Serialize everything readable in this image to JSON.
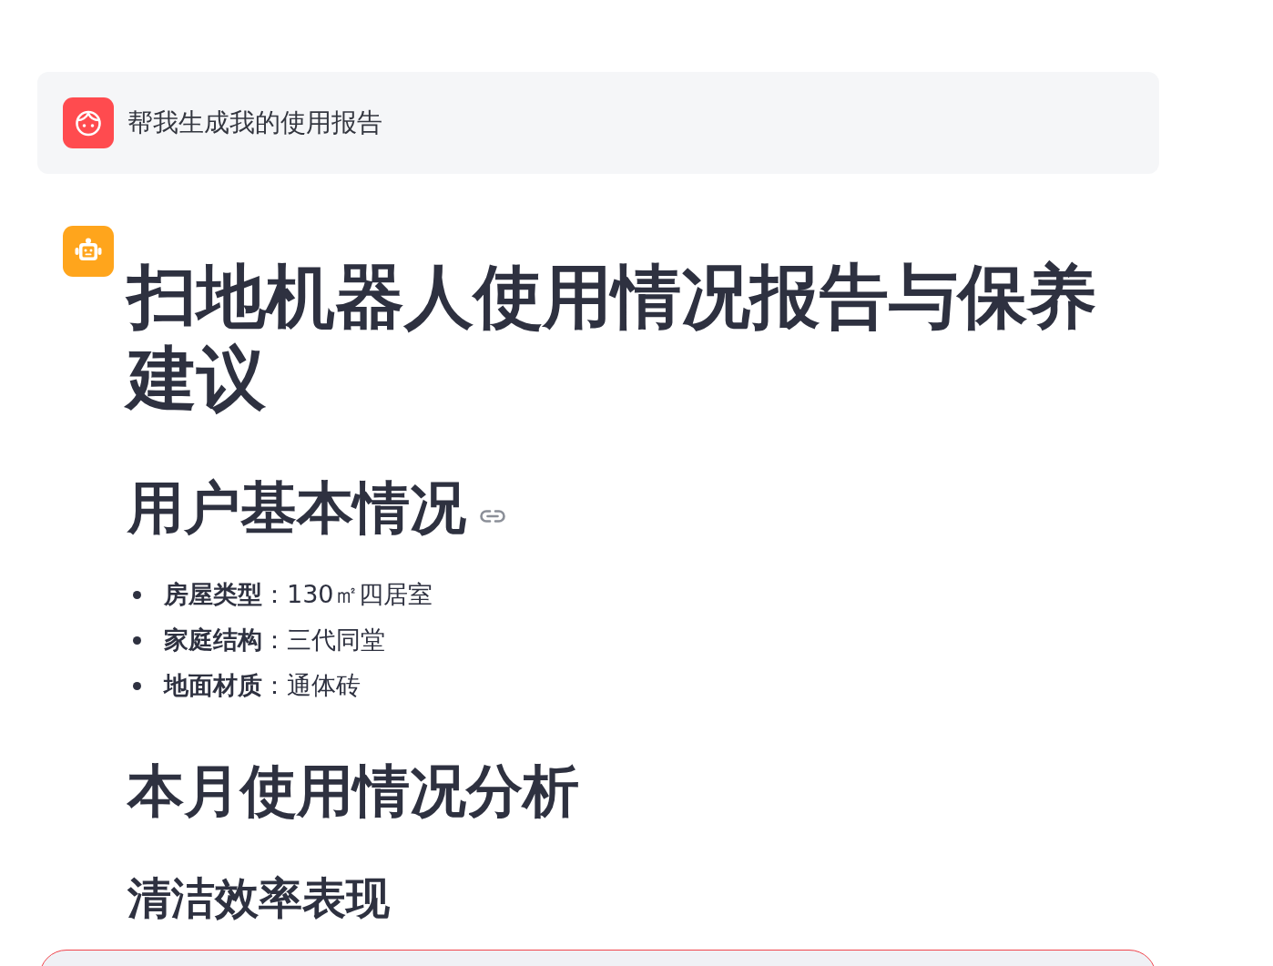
{
  "conversation": [
    {
      "kind": "user_message",
      "text": "帮我生成我的使用报告"
    },
    {
      "kind": "bot_message",
      "blocks": [
        {
          "kind": "h1",
          "text": "扫地机器人使用情况报告与保养建议"
        },
        {
          "kind": "h2",
          "text": "用户基本情况",
          "anchor_link": true
        },
        {
          "kind": "list",
          "items": [
            "**房屋类型**：130㎡四居室",
            "**家庭结构**：三代同堂",
            "**地面材质**：通体砖"
          ]
        },
        {
          "kind": "h2",
          "text": "本月使用情况分析",
          "anchor_link": false
        },
        {
          "kind": "h3",
          "text": "清洁效率表现"
        }
      ]
    }
  ]
}
